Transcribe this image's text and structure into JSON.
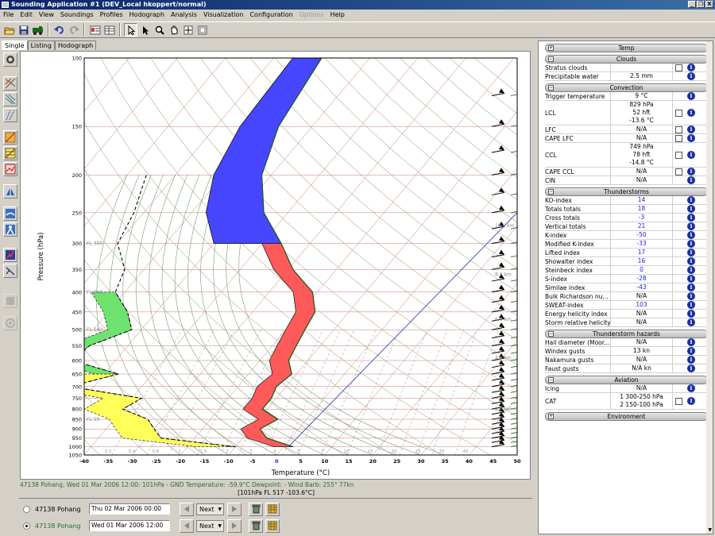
{
  "window": {
    "title": "Sounding Application #1 (DEV_Local hkoppert/normal)",
    "buttons": [
      "_",
      "❐",
      "X"
    ]
  },
  "menu": [
    {
      "label": "File",
      "enabled": true
    },
    {
      "label": "Edit",
      "enabled": true
    },
    {
      "label": "View",
      "enabled": true
    },
    {
      "label": "Soundings",
      "enabled": true
    },
    {
      "label": "Profiles",
      "enabled": true
    },
    {
      "label": "Hodograph",
      "enabled": true
    },
    {
      "label": "Analysis",
      "enabled": true
    },
    {
      "label": "Visualization",
      "enabled": true
    },
    {
      "label": "Configuration",
      "enabled": true
    },
    {
      "label": "Options",
      "enabled": false
    },
    {
      "label": "Help",
      "enabled": true
    }
  ],
  "tabs": [
    "Single",
    "Listing",
    "Hodograph"
  ],
  "chart_data": {
    "type": "skew-t",
    "xlabel": "Temperature (°C)",
    "ylabel": "Pressure (hPa)",
    "x_ticks": [
      -40,
      -35,
      -30,
      -25,
      -20,
      -15,
      -10,
      -5,
      0,
      5,
      10,
      15,
      20,
      25,
      30,
      35,
      40,
      45,
      50
    ],
    "y_ticks": [
      100,
      150,
      200,
      250,
      300,
      350,
      400,
      450,
      500,
      550,
      600,
      650,
      700,
      750,
      800,
      850,
      900,
      950,
      1000,
      1050
    ],
    "xlim": [
      -40,
      50
    ],
    "ylim": [
      1050,
      100
    ],
    "flight_levels": [
      "FL 300",
      "FL 240",
      "FL 180",
      "FL 50"
    ],
    "height_labels": [
      "10,0 km",
      "8,0 km",
      "6,0 km",
      "4,0 km",
      "2,0 km"
    ],
    "mixing_ratio_labels": [
      "0,2",
      "0,4",
      "0,6",
      "1",
      "1,5",
      "2",
      "3",
      "4",
      "5",
      "7",
      "10",
      "15",
      "20",
      "25",
      "30",
      "40"
    ],
    "temperature_profile": [
      [
        1000,
        2
      ],
      [
        950,
        -5
      ],
      [
        900,
        -8
      ],
      [
        850,
        -6
      ],
      [
        800,
        -11
      ],
      [
        750,
        -11
      ],
      [
        700,
        -12
      ],
      [
        650,
        -11
      ],
      [
        600,
        -14
      ],
      [
        550,
        -15
      ],
      [
        500,
        -16
      ],
      [
        450,
        -17
      ],
      [
        400,
        -21
      ],
      [
        350,
        -29
      ],
      [
        300,
        -36
      ],
      [
        250,
        -45
      ],
      [
        200,
        -52
      ],
      [
        150,
        -57
      ],
      [
        100,
        -60
      ]
    ],
    "dewpoint_profile": [
      [
        1000,
        -10
      ],
      [
        950,
        -27
      ],
      [
        900,
        -30
      ],
      [
        850,
        -33
      ],
      [
        800,
        -40
      ],
      [
        750,
        -38
      ],
      [
        700,
        -55
      ],
      [
        650,
        -47
      ],
      [
        600,
        -59
      ],
      [
        550,
        -58
      ],
      [
        500,
        -52
      ],
      [
        450,
        -56
      ],
      [
        400,
        -62
      ],
      [
        350,
        -64
      ],
      [
        300,
        -70
      ],
      [
        250,
        -72
      ],
      [
        200,
        -76
      ]
    ]
  },
  "status": {
    "line1": "47138 Pohang, Wed 01 Mar 2006 12:00:  101hPa  - GND  Temperature: -59.9°C  Dewpoint: -  Wind Barb: 255°  77kn",
    "line2": "[101hPa   FL 517   -103.6°C]"
  },
  "soundings": [
    {
      "station": "47138 Pohang",
      "datetime": "Thu 02 Mar 2006 00:00",
      "next_label": "Next",
      "selected": false
    },
    {
      "station": "47138 Pohang",
      "datetime": "Wed 01 Mar 2006 12:00",
      "next_label": "Next",
      "selected": true
    }
  ],
  "colors": {
    "temperature": "#ff5a5a",
    "cape": "#4646ff",
    "dewpoint_fill": "#ffff5a",
    "dewpoint_green": "#6ee26e",
    "accent": "#0a246a"
  },
  "panel": {
    "sections": [
      {
        "title": "Temp",
        "expanded": false,
        "rows": []
      },
      {
        "title": "Clouds",
        "expanded": true,
        "rows": [
          {
            "label": "Stratus clouds",
            "value": [
              ""
            ],
            "checkbox": true,
            "blue": false
          },
          {
            "label": "Precipitable water",
            "value": [
              "2.5 mm"
            ],
            "checkbox": false,
            "blue": false
          }
        ]
      },
      {
        "title": "Convection",
        "expanded": true,
        "rows": [
          {
            "label": "Trigger temperature",
            "value": [
              "9 °C"
            ],
            "checkbox": false,
            "blue": false
          },
          {
            "label": "LCL",
            "value": [
              "829 hPa",
              "52 hft",
              "-13.6 °C"
            ],
            "checkbox": true,
            "blue": false
          },
          {
            "label": "LFC",
            "value": [
              "N/A"
            ],
            "checkbox": true,
            "blue": false
          },
          {
            "label": "CAPE LFC",
            "value": [
              "N/A"
            ],
            "checkbox": true,
            "blue": false
          },
          {
            "label": "CCL",
            "value": [
              "749 hPa",
              "78 hft",
              "-14.8 °C"
            ],
            "checkbox": true,
            "blue": false
          },
          {
            "label": "CAPE CCL",
            "value": [
              "N/A"
            ],
            "checkbox": true,
            "blue": false
          },
          {
            "label": "CIN",
            "value": [
              "N/A"
            ],
            "checkbox": false,
            "blue": false
          }
        ]
      },
      {
        "title": "Thunderstorms",
        "expanded": true,
        "rows": [
          {
            "label": "KO-index",
            "value": [
              "14"
            ],
            "checkbox": false,
            "blue": true
          },
          {
            "label": "Totals totals",
            "value": [
              "18"
            ],
            "checkbox": false,
            "blue": true
          },
          {
            "label": "Cross totals",
            "value": [
              "-3"
            ],
            "checkbox": false,
            "blue": true
          },
          {
            "label": "Vertical totals",
            "value": [
              "21"
            ],
            "checkbox": false,
            "blue": true
          },
          {
            "label": "K-index",
            "value": [
              "-50"
            ],
            "checkbox": false,
            "blue": true
          },
          {
            "label": "Modified K-index",
            "value": [
              "-33"
            ],
            "checkbox": false,
            "blue": true
          },
          {
            "label": "Lifted index",
            "value": [
              "17"
            ],
            "checkbox": false,
            "blue": true
          },
          {
            "label": "Showalter index",
            "value": [
              "16"
            ],
            "checkbox": false,
            "blue": true
          },
          {
            "label": "Steinbeck index",
            "value": [
              "0"
            ],
            "checkbox": false,
            "blue": true
          },
          {
            "label": "S-index",
            "value": [
              "-28"
            ],
            "checkbox": false,
            "blue": true
          },
          {
            "label": "Similae index",
            "value": [
              "-43"
            ],
            "checkbox": false,
            "blue": true
          },
          {
            "label": "Bulk Richardson nu...",
            "value": [
              "N/A"
            ],
            "checkbox": false,
            "blue": false
          },
          {
            "label": "SWEAT-index",
            "value": [
              "103"
            ],
            "checkbox": false,
            "blue": true
          },
          {
            "label": "Energy helicity index",
            "value": [
              "N/A"
            ],
            "checkbox": false,
            "blue": false
          },
          {
            "label": "Storm relative helicity",
            "value": [
              "N/A"
            ],
            "checkbox": false,
            "blue": false
          }
        ]
      },
      {
        "title": "Thunderstorm hazards",
        "expanded": true,
        "rows": [
          {
            "label": "Hail diameter (Moor...",
            "value": [
              "N/A"
            ],
            "checkbox": false,
            "blue": false
          },
          {
            "label": "Windex gusts",
            "value": [
              "13 kn"
            ],
            "checkbox": false,
            "blue": false
          },
          {
            "label": "Nakamura gusts",
            "value": [
              "N/A"
            ],
            "checkbox": false,
            "blue": false
          },
          {
            "label": "Faust gusts",
            "value": [
              "N/A kn"
            ],
            "checkbox": false,
            "blue": false
          }
        ]
      },
      {
        "title": "Aviation",
        "expanded": true,
        "rows": [
          {
            "label": "Icing",
            "value": [
              "N/A"
            ],
            "checkbox": false,
            "blue": false
          },
          {
            "label": "CAT",
            "value": [
              "1  300-250 hPa",
              "2  150-100 hPa"
            ],
            "checkbox": true,
            "blue": false
          }
        ]
      },
      {
        "title": "Environment",
        "expanded": false,
        "rows": []
      }
    ]
  }
}
